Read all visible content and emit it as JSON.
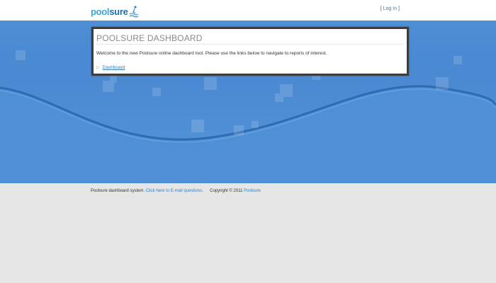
{
  "header": {
    "logo": {
      "text_primary": "pool",
      "text_secondary": "sure",
      "icon": "swimmer-logo-icon"
    },
    "login": {
      "bracket_open": "[",
      "label": "Log In",
      "bracket_close": "]"
    }
  },
  "panel": {
    "title": "POOLSURE DASHBOARD",
    "welcome_text": "Welcome to the new Poolsure online dashboard tool. Please use the links below to navigate to reports of interest.",
    "links": [
      {
        "label": "Dashboard",
        "icon": "chevron-right-icon"
      }
    ]
  },
  "footer": {
    "system_text": "Poolsure dashboard system.",
    "email_link": "Click here to E-mail questions",
    "period": ".",
    "copyright": "Copyright © 2011",
    "company_link": "Poolsure"
  },
  "colors": {
    "brand_light": "#3aa3d8",
    "brand_dark": "#1e6ea8",
    "hero_blue": "#4b8ad2",
    "link": "#2d7fc1",
    "footer_bg": "#e6e6e6"
  }
}
